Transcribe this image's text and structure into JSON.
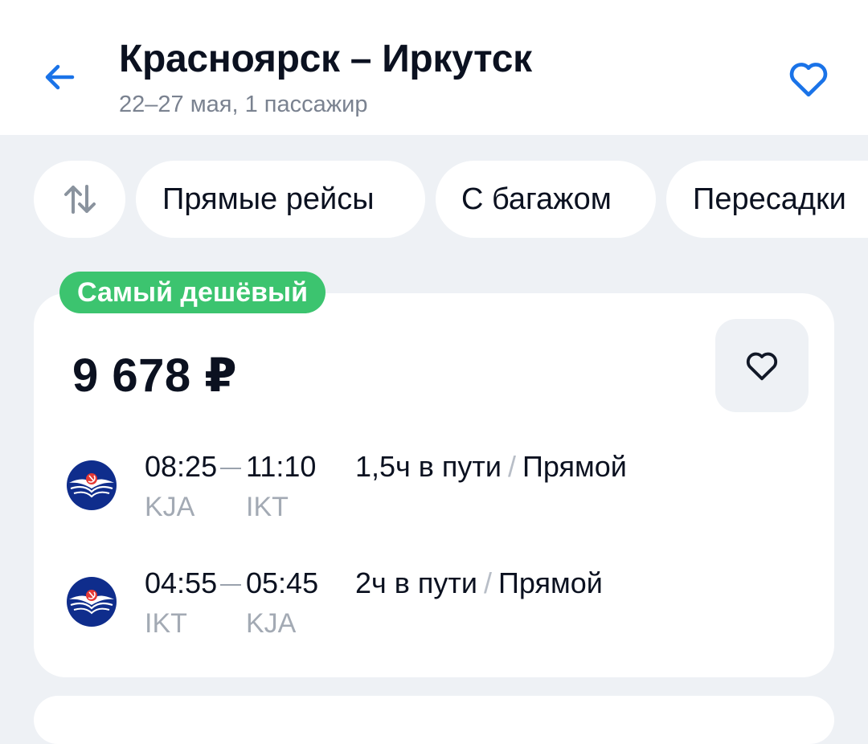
{
  "header": {
    "title": "Красноярск – Иркутск",
    "subtitle": "22–27 мая, 1 пассажир",
    "back_icon": "arrow-left-icon",
    "favorite_icon": "heart-outline-icon"
  },
  "filters": {
    "sort_icon": "sort-arrows-icon",
    "items": [
      {
        "label": "Прямые рейсы"
      },
      {
        "label": "С багажом"
      },
      {
        "label": "Пересадки"
      }
    ]
  },
  "offer": {
    "badge": "Самый дешёвый",
    "badge_color": "#3cc46f",
    "price": "9 678 ₽",
    "favorite_icon": "heart-outline-icon",
    "segments": [
      {
        "airline_icon": "aeroflot-logo-icon",
        "depart_time": "08:25",
        "arrive_time": "11:10",
        "from": "KJA",
        "to": "IKT",
        "duration": "1,5ч в пути",
        "separator": "/",
        "type": "Прямой"
      },
      {
        "airline_icon": "aeroflot-logo-icon",
        "depart_time": "04:55",
        "arrive_time": "05:45",
        "from": "IKT",
        "to": "KJA",
        "duration": "2ч в пути",
        "separator": "/",
        "type": "Прямой"
      }
    ]
  },
  "colors": {
    "accent": "#1a73e8",
    "background": "#eef1f5",
    "airline_logo": "#0f2d8c"
  }
}
